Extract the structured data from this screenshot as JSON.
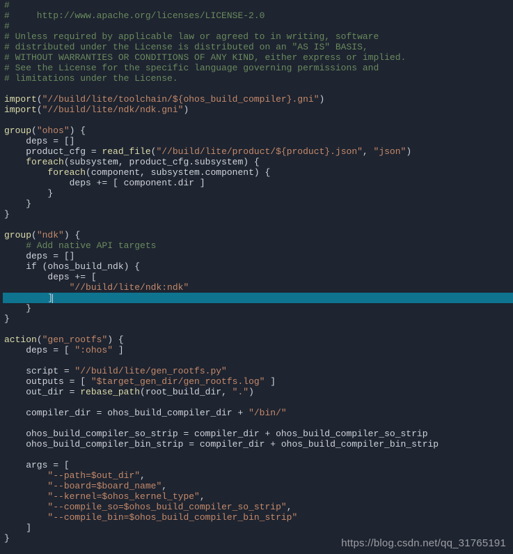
{
  "code": {
    "lines": [
      "#",
      "#     http://www.apache.org/licenses/LICENSE-2.0",
      "#",
      "# Unless required by applicable law or agreed to in writing, software",
      "# distributed under the License is distributed on an \"AS IS\" BASIS,",
      "# WITHOUT WARRANTIES OR CONDITIONS OF ANY KIND, either express or implied.",
      "# See the License for the specific language governing permissions and",
      "# limitations under the License.",
      "",
      "import(\"//build/lite/toolchain/${ohos_build_compiler}.gni\")",
      "import(\"//build/lite/ndk/ndk.gni\")",
      "",
      "group(\"ohos\") {",
      "    deps = []",
      "    product_cfg = read_file(\"//build/lite/product/${product}.json\", \"json\")",
      "    foreach(subsystem, product_cfg.subsystem) {",
      "        foreach(component, subsystem.component) {",
      "            deps += [ component.dir ]",
      "        }",
      "    }",
      "}",
      "",
      "group(\"ndk\") {",
      "    # Add native API targets",
      "    deps = []",
      "    if (ohos_build_ndk) {",
      "        deps += [",
      "            \"//build/lite/ndk:ndk\"",
      "        ]",
      "    }",
      "}",
      "",
      "action(\"gen_rootfs\") {",
      "    deps = [ \":ohos\" ]",
      "",
      "    script = \"//build/lite/gen_rootfs.py\"",
      "    outputs = [ \"$target_gen_dir/gen_rootfs.log\" ]",
      "    out_dir = rebase_path(root_build_dir, \".\")",
      "",
      "    compiler_dir = ohos_build_compiler_dir + \"/bin/\"",
      "",
      "    ohos_build_compiler_so_strip = compiler_dir + ohos_build_compiler_so_strip",
      "    ohos_build_compiler_bin_strip = compiler_dir + ohos_build_compiler_bin_strip",
      "",
      "    args = [",
      "        \"--path=$out_dir\",",
      "        \"--board=$board_name\",",
      "        \"--kernel=$ohos_kernel_type\",",
      "        \"--compile_so=$ohos_build_compiler_so_strip\",",
      "        \"--compile_bin=$ohos_build_compiler_bin_strip\"",
      "    ]",
      "}"
    ],
    "highlighted_index": 28
  },
  "watermark": "https://blog.csdn.net/qq_31765191"
}
